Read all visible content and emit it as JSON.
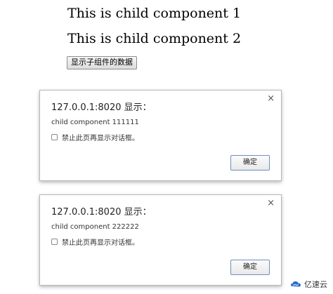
{
  "page": {
    "child_lines": [
      "This is child component 1",
      "This is child component 2"
    ],
    "show_button_label": "显示子组件的数据"
  },
  "dialogs": [
    {
      "title": "127.0.0.1:8020 显示：",
      "message": "child component 111111",
      "checkbox_label": "禁止此页再显示对话框。",
      "ok_label": "确定",
      "close_glyph": "×"
    },
    {
      "title": "127.0.0.1:8020 显示：",
      "message": "child component 222222",
      "checkbox_label": "禁止此页再显示对话框。",
      "ok_label": "确定",
      "close_glyph": "×"
    }
  ],
  "watermark": {
    "text": "亿速云",
    "logo_icon": "cloud-logo-icon"
  },
  "colors": {
    "ok_border": "#6f8fc0",
    "dialog_border": "#b8b8b8",
    "logo_blue": "#2b6cc4"
  }
}
